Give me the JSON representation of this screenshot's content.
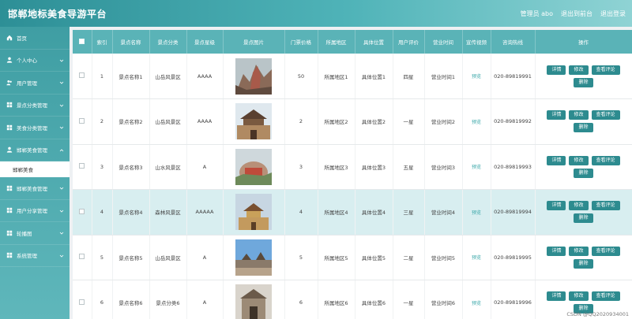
{
  "header": {
    "title": "邯郸地标美食导游平台",
    "admin": "管理员 abo",
    "frontend_link": "退出到前台",
    "logout": "退出登录"
  },
  "sidebar": {
    "items": [
      {
        "label": "首页",
        "icon": "home-icon"
      },
      {
        "label": "个人中心",
        "icon": "user-icon"
      },
      {
        "label": "用户管理",
        "icon": "people-icon"
      },
      {
        "label": "景点分类管理",
        "icon": "grid-icon"
      },
      {
        "label": "美食分类管理",
        "icon": "grid-icon"
      },
      {
        "label": "邯郸美食管理",
        "icon": "user-icon"
      },
      {
        "label": "邯郸美食",
        "icon": ""
      },
      {
        "label": "邯郸美食管理",
        "icon": "grid-icon"
      },
      {
        "label": "用户分享管理",
        "icon": "grid-icon"
      },
      {
        "label": "轮播图",
        "icon": "grid-icon"
      },
      {
        "label": "系统管理",
        "icon": "grid-icon"
      }
    ]
  },
  "table": {
    "headers": [
      "索引",
      "景点名称",
      "景点分类",
      "景点星级",
      "景点图片",
      "门票价格",
      "所属地区",
      "具体位置",
      "用户评价",
      "营业时间",
      "宣传视频",
      "咨询热线",
      "操作"
    ],
    "rows": [
      {
        "index": "1",
        "name": "景点名称1",
        "category": "山岳风景区",
        "stars": "AAAA",
        "price": "50",
        "region": "所属地区1",
        "location": "具体位置1",
        "rating": "四星",
        "hours": "营业时间1",
        "video": "预览",
        "hotline": "020-89819991"
      },
      {
        "index": "2",
        "name": "景点名称2",
        "category": "山岳风景区",
        "stars": "AAAA",
        "price": "2",
        "region": "所属地区2",
        "location": "具体位置2",
        "rating": "一星",
        "hours": "营业时间2",
        "video": "预览",
        "hotline": "020-89819992"
      },
      {
        "index": "3",
        "name": "景点名称3",
        "category": "山水风景区",
        "stars": "A",
        "price": "3",
        "region": "所属地区3",
        "location": "具体位置3",
        "rating": "五星",
        "hours": "营业时间3",
        "video": "预览",
        "hotline": "020-89819993"
      },
      {
        "index": "4",
        "name": "景点名称4",
        "category": "森林风景区",
        "stars": "AAAAA",
        "price": "4",
        "region": "所属地区4",
        "location": "具体位置4",
        "rating": "三星",
        "hours": "营业时间4",
        "video": "预览",
        "hotline": "020-89819994"
      },
      {
        "index": "5",
        "name": "景点名称5",
        "category": "山岳风景区",
        "stars": "A",
        "price": "5",
        "region": "所属地区5",
        "location": "具体位置5",
        "rating": "二星",
        "hours": "营业时间5",
        "video": "预览",
        "hotline": "020-89819995"
      },
      {
        "index": "6",
        "name": "景点名称6",
        "category": "景点分类6",
        "stars": "A",
        "price": "6",
        "region": "所属地区6",
        "location": "具体位置6",
        "rating": "一星",
        "hours": "营业时间6",
        "video": "预览",
        "hotline": "020-89819996"
      }
    ],
    "actions": {
      "detail": "详情",
      "edit": "修改",
      "comments": "查看评论",
      "delete": "删除"
    }
  },
  "watermark": "CSDN @QQ2020934001"
}
